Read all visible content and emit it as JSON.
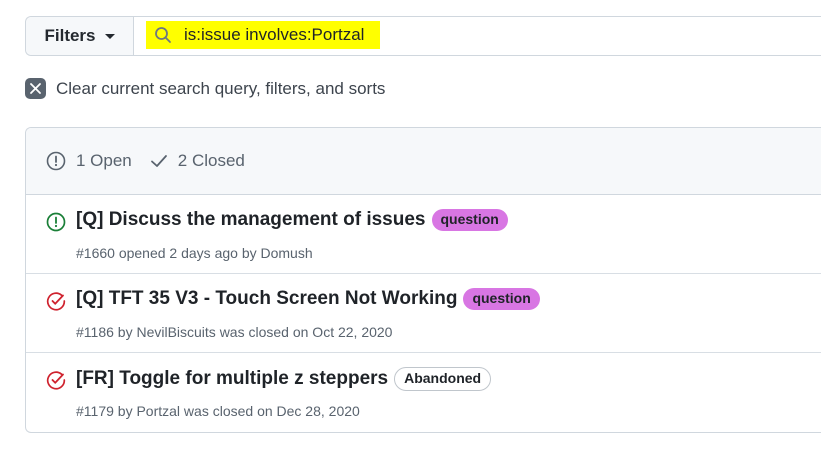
{
  "filter_bar": {
    "filters_label": "Filters",
    "search_value": "is:issue involves:Portzal"
  },
  "clear": {
    "label": "Clear current search query, filters, and sorts"
  },
  "states": {
    "open_label": "1 Open",
    "closed_label": "2 Closed"
  },
  "issues": [
    {
      "title": "[Q] Discuss the management of issues",
      "label": "question",
      "meta": "#1660 opened 2 days ago by Domush",
      "state": "open"
    },
    {
      "title": "[Q] TFT 35 V3 - Touch Screen Not Working",
      "label": "question",
      "meta": "#1186 by NevilBiscuits was closed on Oct 22, 2020",
      "state": "closed"
    },
    {
      "title": "[FR] Toggle for multiple z steppers",
      "label": "Abandoned",
      "meta": "#1179 by Portzal was closed on Dec 28, 2020",
      "state": "closed"
    }
  ],
  "colors": {
    "open": "#1a7f37",
    "closed": "#cf222e",
    "question_label": "#d876e3",
    "highlight": "#ffff00"
  }
}
